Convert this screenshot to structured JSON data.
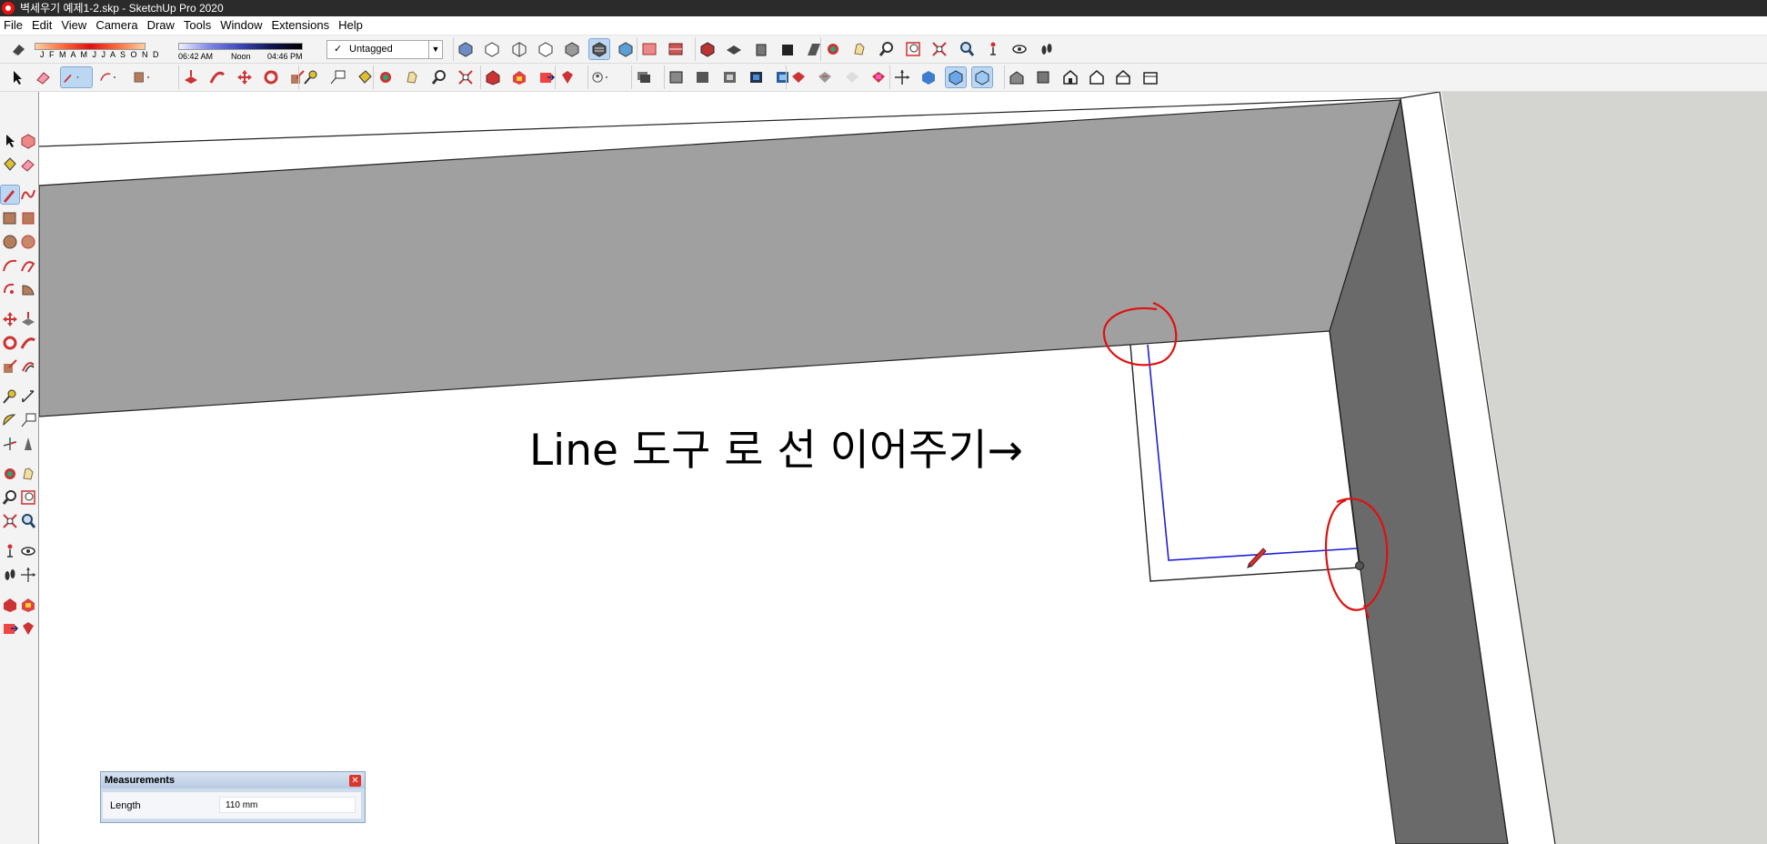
{
  "window": {
    "title": "벽세우기 예제1-2.skp - SketchUp Pro 2020"
  },
  "menu": [
    "File",
    "Edit",
    "View",
    "Camera",
    "Draw",
    "Tools",
    "Window",
    "Extensions",
    "Help"
  ],
  "shadows": {
    "months": "J F M A M J J A S O N D",
    "times": {
      "start": "06:42 AM",
      "mid": "Noon",
      "end": "04:46 PM"
    }
  },
  "tag": {
    "selected": "Untagged"
  },
  "annotation": {
    "text": "Line 도구 로 선 이어주기→"
  },
  "measurements": {
    "title": "Measurements",
    "label": "Length",
    "value": "110 mm"
  },
  "colors": {
    "wall_light": "#a0a0a0",
    "wall_dark": "#6a6a6a",
    "floor_right": "#d4d4d0",
    "inference_line": "#1f1fd8",
    "highlight_circle": "#e01010",
    "active_button": "#bcd7f2"
  },
  "icons": {
    "row1": [
      "eraser-style-icon",
      "shaded-views-icons",
      "section-icons",
      "camera-icons"
    ],
    "row2": [
      "select-icon",
      "eraser-icon",
      "line-pencil-icon",
      "arc-icon",
      "shape-icon",
      "move-rotate-icons",
      "tape-measure-icon",
      "orbit-pan-zoom-icons",
      "warehouse-icons",
      "view-icons"
    ]
  }
}
